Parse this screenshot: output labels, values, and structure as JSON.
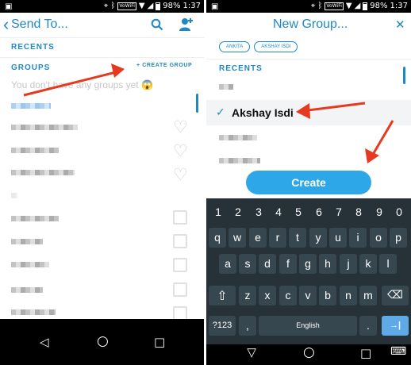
{
  "left": {
    "status": {
      "left_icon": "image-icon",
      "battery": "98%",
      "time": "1:37",
      "vowifi": "VoWiFi"
    },
    "header": {
      "back": "‹",
      "title": "Send To...",
      "search_icon": "search-icon",
      "add_friend_icon": "add-friend-icon"
    },
    "recents_label": "RECENTS",
    "groups_label": "GROUPS",
    "create_group": "+ CREATE GROUP",
    "empty_text": "You don't have any groups yet 😱"
  },
  "right": {
    "status": {
      "left_icon": "image-icon",
      "battery": "98%",
      "time": "1:37",
      "vowifi": "VoWiFi"
    },
    "header": {
      "title": "New Group...",
      "close": "✕"
    },
    "chips": [
      "ANKITA",
      "AKSHAY ISDI"
    ],
    "recents_label": "RECENTS",
    "selected_name": "Akshay Isdi",
    "check": "✓",
    "create_button": "Create",
    "keyboard": {
      "digits": [
        "1",
        "2",
        "3",
        "4",
        "5",
        "6",
        "7",
        "8",
        "9",
        "0"
      ],
      "row1": [
        "q",
        "w",
        "e",
        "r",
        "t",
        "y",
        "u",
        "i",
        "o",
        "p"
      ],
      "row2": [
        "a",
        "s",
        "d",
        "f",
        "g",
        "h",
        "j",
        "k",
        "l"
      ],
      "row3": [
        "z",
        "x",
        "c",
        "v",
        "b",
        "n",
        "m"
      ],
      "shift": "⇧",
      "backspace": "⌫",
      "sym": "?123",
      "comma": ",",
      "space": "English",
      "period": ".",
      "enter": "→|"
    }
  },
  "nav": {
    "back": "◁",
    "home": "○",
    "recents": "□",
    "keyboard": "⌨"
  },
  "colors": {
    "accent": "#1e88c7",
    "create_button": "#2ea7e8",
    "arrow": "#e53920"
  }
}
